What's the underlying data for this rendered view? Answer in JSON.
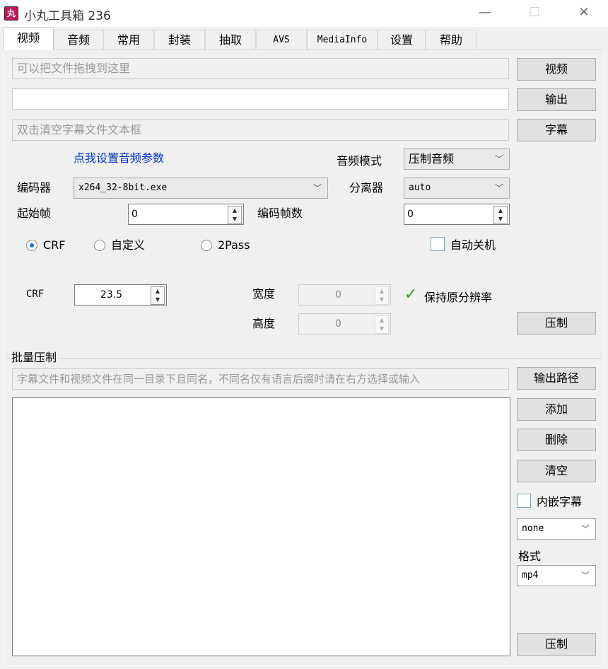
{
  "window": {
    "title": "小丸工具箱 236",
    "app_icon": "丸",
    "minimize": "—",
    "maximize": "☐",
    "close": "✕"
  },
  "tabs": [
    "视频",
    "音频",
    "常用",
    "封装",
    "抽取",
    "AVS",
    "MediaInfo",
    "设置",
    "帮助"
  ],
  "video": {
    "input_placeholder": "可以把文件拖拽到这里",
    "video_button": "视频",
    "output_value": "",
    "output_button": "输出",
    "subtitle_placeholder": "双击清空字幕文件文本框",
    "subtitle_button": "字幕",
    "audio_settings_link": "点我设置音频参数",
    "audio_mode_label": "音频模式",
    "audio_mode_value": "压制音频",
    "encoder_label": "编码器",
    "encoder_value": "x264_32-8bit.exe",
    "splitter_label": "分离器",
    "splitter_value": "auto",
    "start_frame_label": "起始帧",
    "start_frame_value": "0",
    "encode_frames_label": "编码帧数",
    "encode_frames_value": "0",
    "mode_crf": "CRF",
    "mode_custom": "自定义",
    "mode_2pass": "2Pass",
    "auto_shutdown": "自动关机",
    "crf_label": "CRF",
    "crf_value": "23.5",
    "width_label": "宽度",
    "width_value": "0",
    "height_label": "高度",
    "height_value": "0",
    "keep_resolution": "保持原分辨率",
    "encode_button": "压制"
  },
  "batch": {
    "group_title": "批量压制",
    "hint_placeholder": "字幕文件和视频文件在同一目录下且同名，不同名仅有语言后缀时请在右方选择或输入",
    "output_path_button": "输出路径",
    "add_button": "添加",
    "delete_button": "删除",
    "clear_button": "清空",
    "embed_subtitle": "内嵌字幕",
    "subtitle_lang_value": "none",
    "format_label": "格式",
    "format_value": "mp4",
    "encode_button": "压制"
  }
}
